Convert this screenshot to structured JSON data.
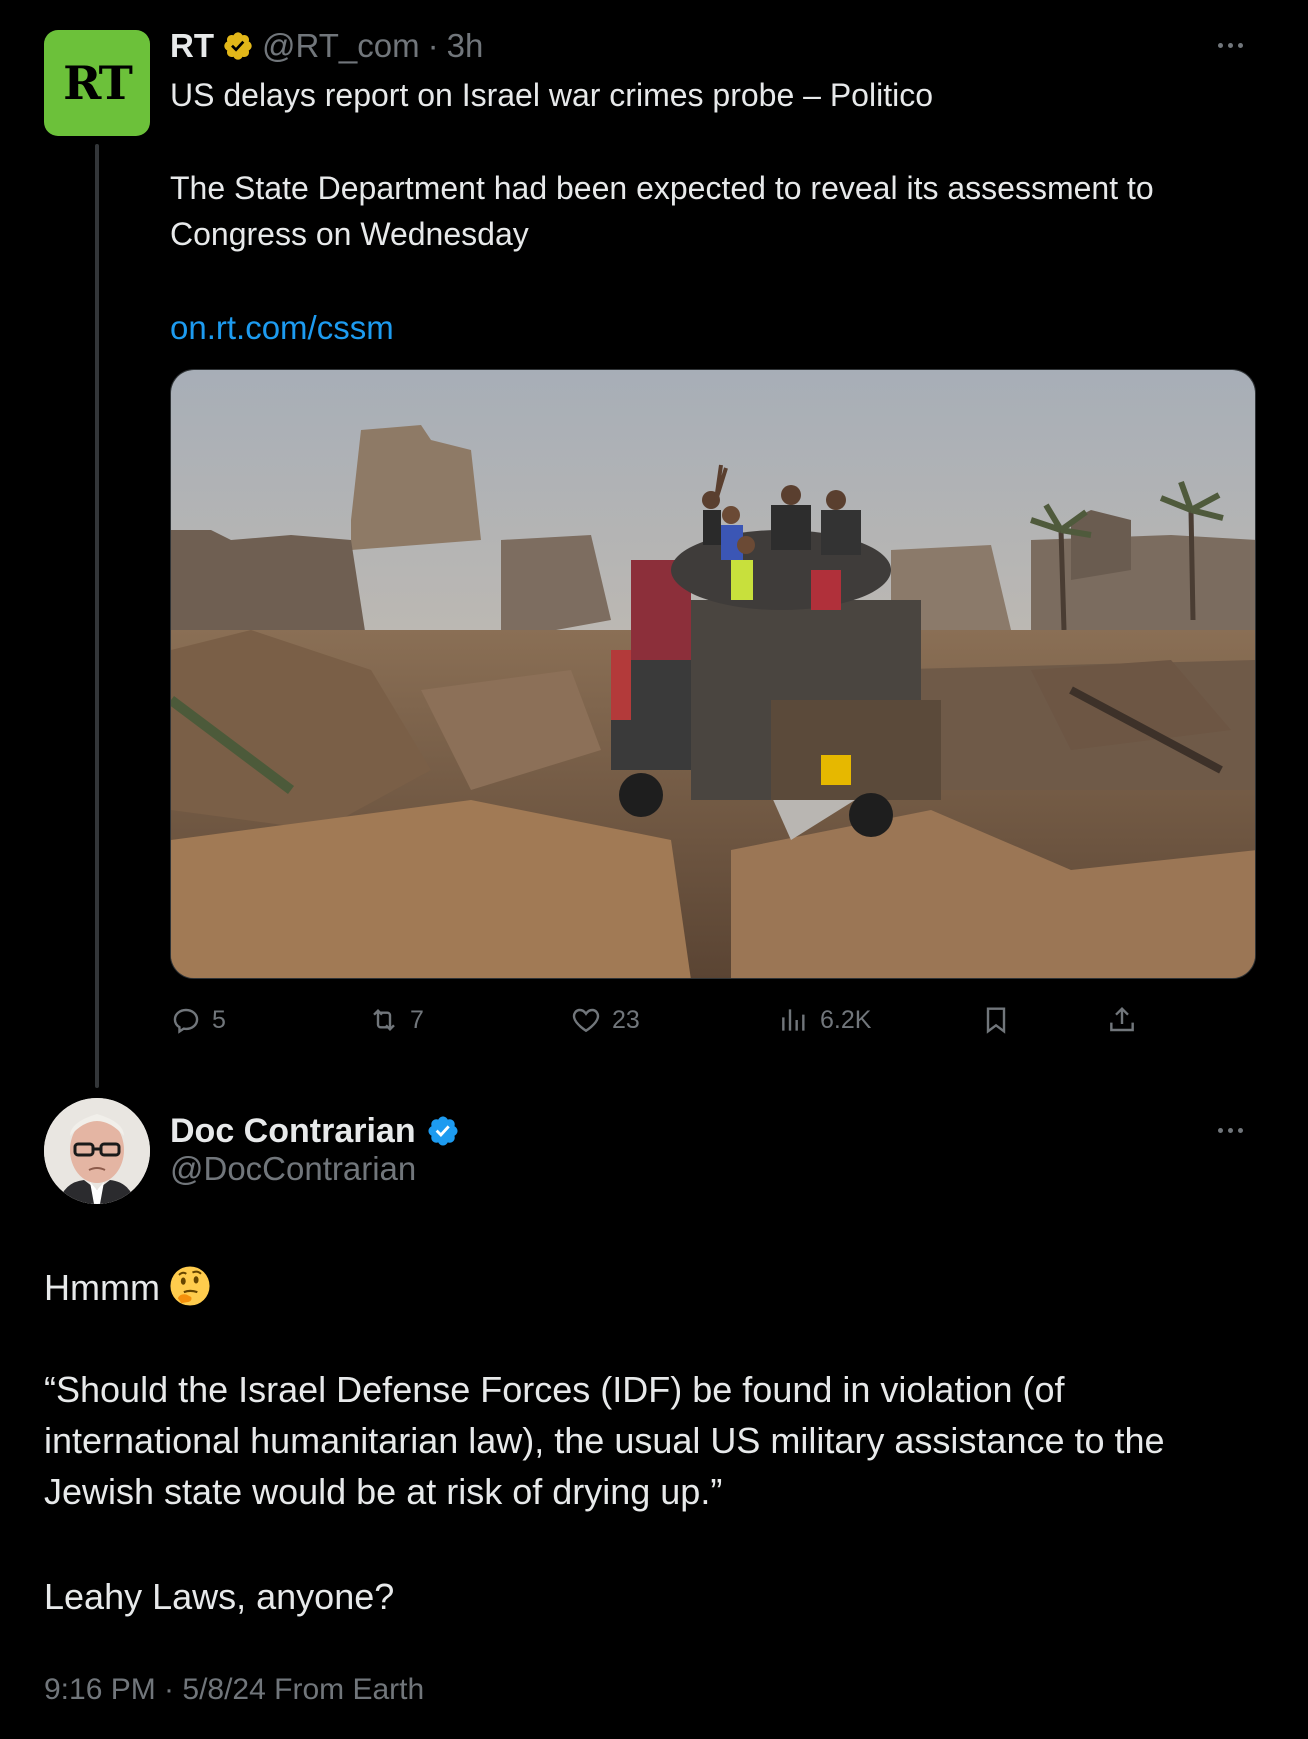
{
  "colors": {
    "background": "#000000",
    "text_primary": "#e7e9ea",
    "text_secondary": "#71767b",
    "link": "#1d9bf0",
    "rt_brand": "#6cc13a",
    "verified_gold": "#e2b719",
    "verified_blue": "#1d9bf0"
  },
  "parent_tweet": {
    "avatar_text": "RT",
    "name": "RT",
    "handle": "@RT_com",
    "separator": "·",
    "time": "3h",
    "verified_icon": "gold-verified-badge-icon",
    "headline": "US delays report on Israel war crimes probe – Politico",
    "body_line1": "The State Department had been expected to reveal its assessment to",
    "body_line2": "Congress on Wednesday",
    "link": "on.rt.com/cssm",
    "media_icon": "photo-destroyed-buildings-truck",
    "actions": {
      "replies": "5",
      "reposts": "7",
      "likes": "23",
      "views": "6.2K"
    }
  },
  "main_tweet": {
    "name": "Doc Contrarian",
    "handle": "@DocContrarian",
    "verified_icon": "blue-verified-badge-icon",
    "line_hmmm": "Hmmm",
    "emoji": "thinking-face-emoji",
    "quote_line1": "“Should the Israel Defense Forces (IDF) be found in violation (of",
    "quote_line2": "international humanitarian law), the usual US military assistance to the",
    "quote_line3": "Jewish state would be at risk of drying up.”",
    "closing": "Leahy Laws, anyone?",
    "meta": "9:16 PM · 5/8/24 From Earth"
  }
}
